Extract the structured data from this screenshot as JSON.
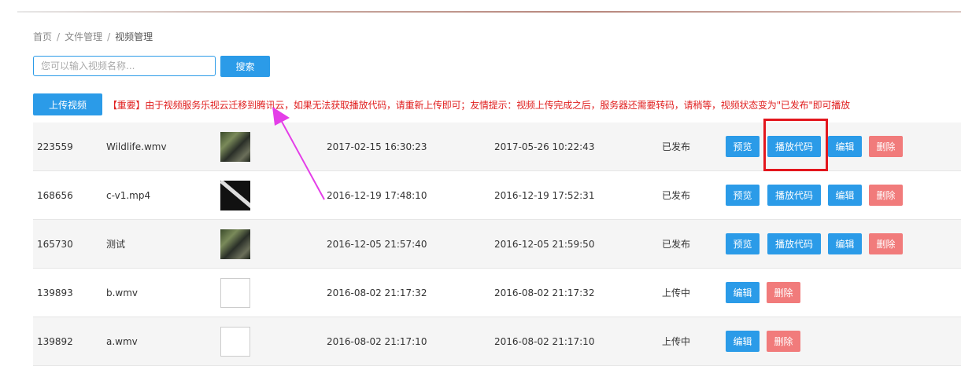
{
  "breadcrumb": {
    "home": "首页",
    "files": "文件管理",
    "current": "视频管理"
  },
  "search": {
    "placeholder": "您可以输入视频名称...",
    "button": "搜索"
  },
  "toolbar": {
    "upload_button": "上传视频"
  },
  "notice": "【重要】由于视频服务乐视云迁移到腾讯云，如果无法获取播放代码，请重新上传即可；友情提示：视频上传完成之后，服务器还需要转码，请稍等，视频状态变为\"已发布\"即可播放",
  "actions": {
    "preview": "预览",
    "code": "播放代码",
    "edit": "编辑",
    "delete": "删除"
  },
  "rows": [
    {
      "id": "223559",
      "name": "Wildlife.wmv",
      "thumb": "nature",
      "created": "2017-02-15 16:30:23",
      "updated": "2017-05-26 10:22:43",
      "status": "已发布",
      "published": true
    },
    {
      "id": "168656",
      "name": "c-v1.mp4",
      "thumb": "dark",
      "created": "2016-12-19 17:48:10",
      "updated": "2016-12-19 17:52:31",
      "status": "已发布",
      "published": true
    },
    {
      "id": "165730",
      "name": "测试",
      "thumb": "nature",
      "created": "2016-12-05 21:57:40",
      "updated": "2016-12-05 21:59:50",
      "status": "已发布",
      "published": true
    },
    {
      "id": "139893",
      "name": "b.wmv",
      "thumb": "empty",
      "created": "2016-08-02 21:17:32",
      "updated": "2016-08-02 21:17:32",
      "status": "上传中",
      "published": false
    },
    {
      "id": "139892",
      "name": "a.wmv",
      "thumb": "empty",
      "created": "2016-08-02 21:17:10",
      "updated": "2016-08-02 21:17:10",
      "status": "上传中",
      "published": false
    }
  ],
  "colors": {
    "accent": "#2b9be8",
    "danger": "#f17b7b",
    "notice": "#e02020",
    "highlight_box": "#e3161d",
    "arrow": "#e43ee8"
  }
}
